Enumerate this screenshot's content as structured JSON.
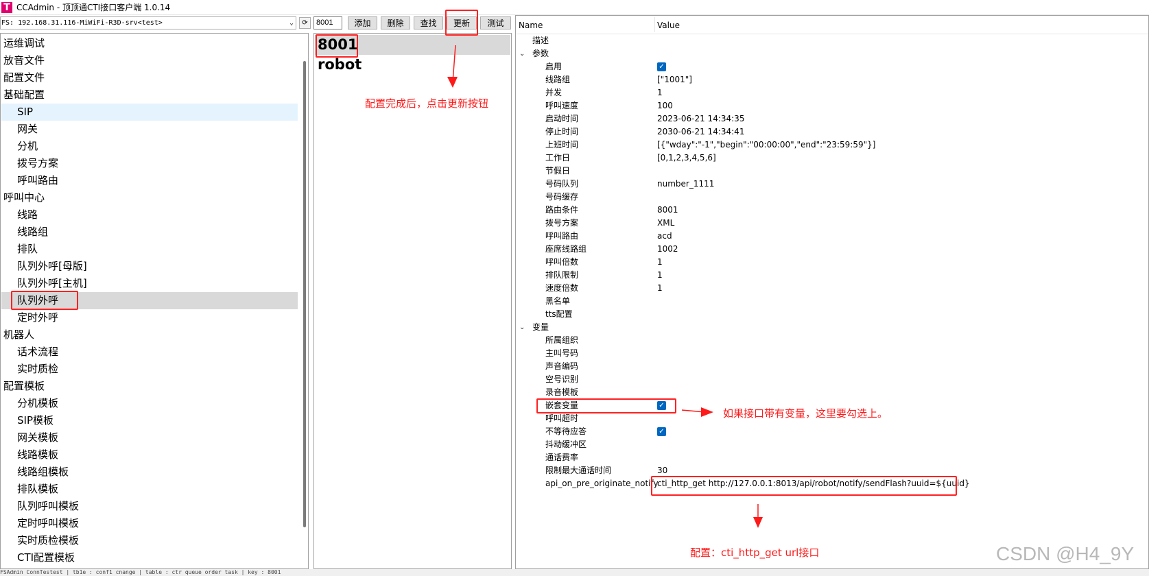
{
  "window": {
    "app_icon": "T",
    "title": "CCAdmin - 顶顶通CTI接口客户端 1.0.14"
  },
  "toolbar": {
    "fs_value": "FS: 192.168.31.116-MiWiFi-R3D-srv<test>",
    "refresh_icon": "⟳",
    "id_value": "8001",
    "add_label": "添加",
    "delete_label": "删除",
    "find_label": "查找",
    "update_label": "更新",
    "test_label": "测试"
  },
  "nav": {
    "items": [
      "运维调试",
      "放音文件",
      "配置文件",
      "基础配置",
      "SIP",
      "网关",
      "分机",
      "拨号方案",
      "呼叫路由",
      "呼叫中心",
      "线路",
      "线路组",
      "排队",
      "队列外呼[母版]",
      "队列外呼[主机]",
      "队列外呼",
      "定时外呼",
      "机器人",
      "话术流程",
      "实时质检",
      "配置模板",
      "分机模板",
      "SIP模板",
      "网关模板",
      "线路模板",
      "线路组模板",
      "排队模板",
      "队列呼叫模板",
      "定时呼叫模板",
      "实时质检模板",
      "CTI配置模板"
    ]
  },
  "list": {
    "items": [
      "8001",
      "robot"
    ]
  },
  "grid": {
    "header_name": "Name",
    "header_value": "Value",
    "describe": "描述",
    "params_group": "参数",
    "enable": "启用",
    "line_group": "线路组",
    "line_group_val": "[\"1001\"]",
    "concurrency": "并发",
    "concurrency_val": "1",
    "call_speed": "呼叫速度",
    "call_speed_val": "100",
    "start_time": "启动时间",
    "start_time_val": "2023-06-21 14:34:35",
    "stop_time": "停止时间",
    "stop_time_val": "2030-06-21 14:34:41",
    "work_hours": "上班时间",
    "work_hours_val": "[{\"wday\":\"-1\",\"begin\":\"00:00:00\",\"end\":\"23:59:59\"}]",
    "work_days": "工作日",
    "work_days_val": "[0,1,2,3,4,5,6]",
    "holiday": "节假日",
    "number_queue": "号码队列",
    "number_queue_val": "number_1111",
    "number_cache": "号码缓存",
    "route_cond": "路由条件",
    "route_cond_val": "8001",
    "dial_plan": "拨号方案",
    "dial_plan_val": "XML",
    "call_route": "呼叫路由",
    "call_route_val": "acd",
    "seat_line_group": "座席线路组",
    "seat_line_group_val": "1002",
    "call_multiple": "呼叫倍数",
    "call_multiple_val": "1",
    "queue_limit": "排队限制",
    "queue_limit_val": "1",
    "speed_multiple": "速度倍数",
    "speed_multiple_val": "1",
    "blacklist": "黑名单",
    "tts_config": "tts配置",
    "vars_group": "变量",
    "org": "所属组织",
    "caller": "主叫号码",
    "voice_code": "声音编码",
    "empty_detect": "空号识别",
    "record_tpl": "录音模板",
    "nested_vars": "嵌套变量",
    "call_timeout": "呼叫超时",
    "no_wait_answer": "不等待应答",
    "jitter_buffer": "抖动缓冲区",
    "call_rate": "通话费率",
    "max_call_time": "限制最大通话时间",
    "max_call_time_val": "30",
    "api_name": "api_on_pre_originate_notify",
    "api_val": "cti_http_get http://127.0.0.1:8013/api/robot/notify/sendFlash?uuid=${uuid}",
    "check_mark": "✓"
  },
  "annotations": {
    "update_note": "配置完成后，点击更新按钮",
    "vars_note": "如果接口带有变量，这里要勾选上。",
    "api_note": "配置：cti_http_get url接口"
  },
  "watermark": "CSDN @H4_9Y",
  "statusbar": "FSAdmin ConnTestest | tb1e : conf1 cnange | table : ctr queue order task | key : 8001"
}
